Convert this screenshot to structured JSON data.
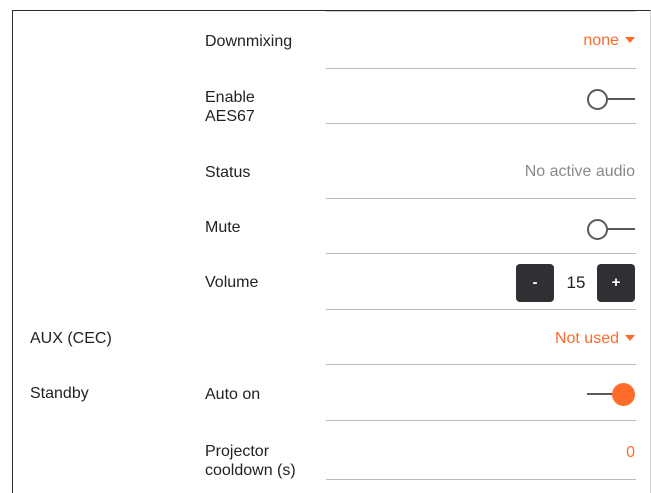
{
  "rows": {
    "downmixing": {
      "label": "Downmixing",
      "value": "none"
    },
    "aes67": {
      "label_line1": "Enable",
      "label_line2": "AES67",
      "toggle": "off"
    },
    "status": {
      "label": "Status",
      "value": "No active audio"
    },
    "mute": {
      "label": "Mute",
      "toggle": "off"
    },
    "volume": {
      "label": "Volume",
      "value": "15",
      "decrement": "-",
      "increment": "+"
    },
    "aux": {
      "section": "AUX (CEC)",
      "value": "Not used"
    },
    "standby": {
      "section": "Standby",
      "label": "Auto on",
      "toggle": "on"
    },
    "cooldown": {
      "label_line1": "Projector",
      "label_line2": "cooldown (s)",
      "value": "0"
    }
  },
  "colors": {
    "accent": "#ff6b2b",
    "button_bg": "#2e3033",
    "muted_text": "#8a8a8a"
  },
  "icons": {
    "dropdown": "caret-down-icon",
    "toggle": "toggle-switch"
  }
}
